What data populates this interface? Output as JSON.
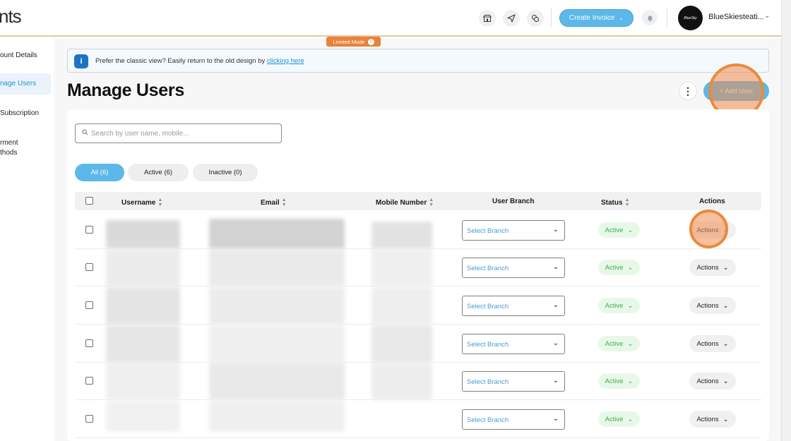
{
  "topbar": {
    "brand_fragment": "nts",
    "icons": [
      "store-icon",
      "send-icon",
      "coins-icon"
    ],
    "create_invoice_label": "Create Invoice",
    "account_name": "BlueSkiesteati...",
    "avatar_text": "BlueSky"
  },
  "sidebar": {
    "items": [
      {
        "line1": "ount Details",
        "line2": ""
      },
      {
        "line1": "nage Users",
        "line2": ""
      },
      {
        "line1": "Subscription",
        "line2": ""
      },
      {
        "line1": "rment",
        "line2": "thods"
      }
    ]
  },
  "badge": {
    "limited_mode": "Limited Mode"
  },
  "banner": {
    "text": "Prefer the classic view? Easily return to the old design by ",
    "link": "clicking here"
  },
  "page": {
    "title": "Manage Users",
    "add_user_label": "+ Add User"
  },
  "search": {
    "placeholder": "Search by user name, mobile..."
  },
  "filters": [
    {
      "label": "All (6)",
      "active": true
    },
    {
      "label": "Active (6)",
      "active": false
    },
    {
      "label": "Inactive (0)",
      "active": false
    }
  ],
  "table": {
    "columns": [
      "Username",
      "Email",
      "Mobile Number",
      "User Branch",
      "Status",
      "Actions"
    ],
    "rows": [
      {
        "branch": "Select Branch",
        "status": "Active",
        "action": "Actions"
      },
      {
        "branch": "Select Branch",
        "status": "Active",
        "action": "Actions"
      },
      {
        "branch": "Select Branch",
        "status": "Active",
        "action": "Actions"
      },
      {
        "branch": "Select Branch",
        "status": "Active",
        "action": "Actions"
      },
      {
        "branch": "Select Branch",
        "status": "Active",
        "action": "Actions"
      },
      {
        "branch": "Select Branch",
        "status": "Active",
        "action": "Actions"
      }
    ]
  },
  "colors": {
    "accent": "#5bb8e8",
    "limited_badge": "#e9823a",
    "status_active_text": "#3fae49",
    "status_active_bg": "#e8f8e8",
    "highlight": "#ea8a3a"
  }
}
